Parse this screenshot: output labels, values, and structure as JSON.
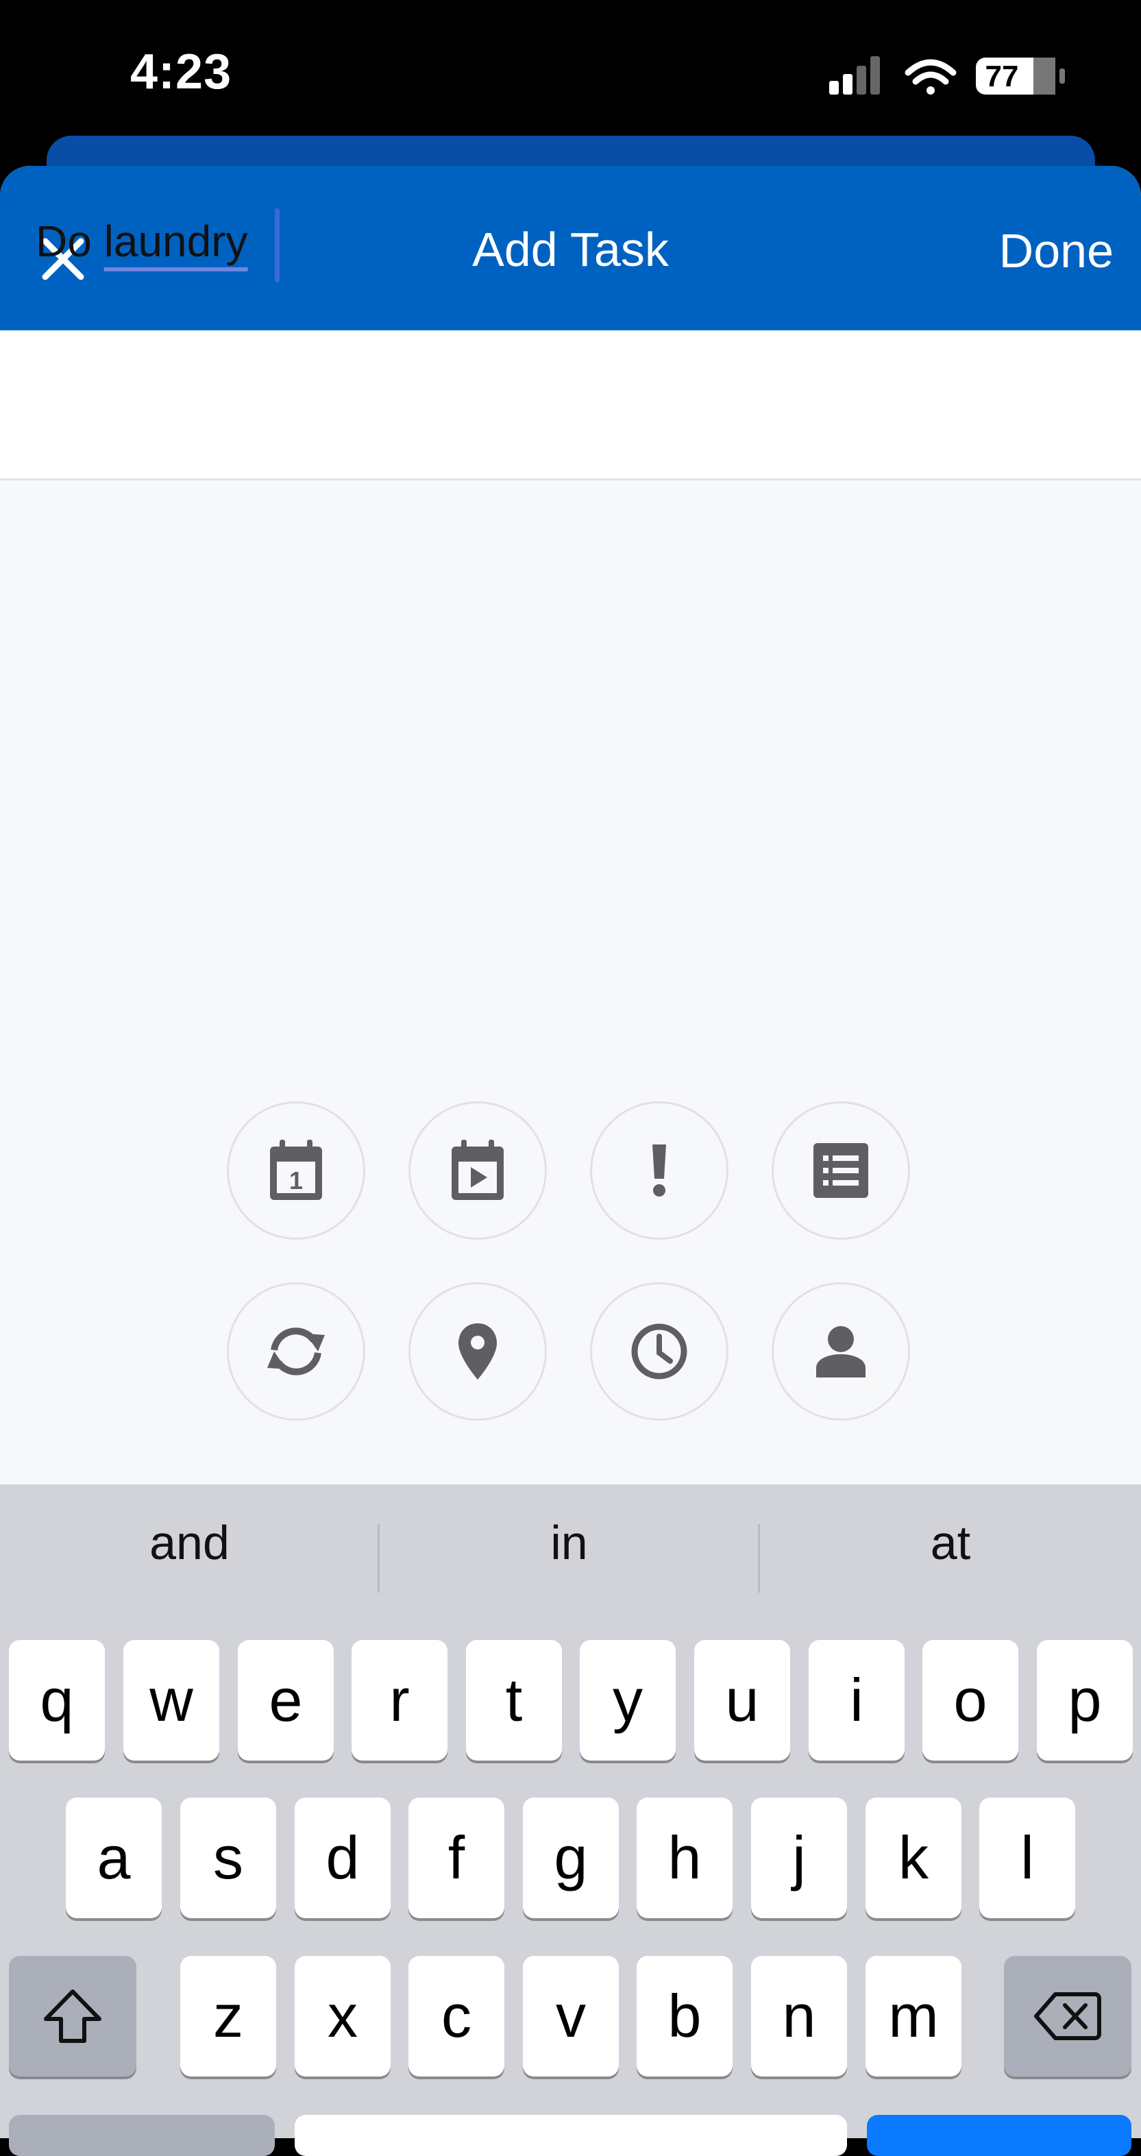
{
  "status_bar": {
    "time": "4:23",
    "battery": "77",
    "icons": [
      "cellular-signal-icon",
      "wifi-icon",
      "battery-icon"
    ]
  },
  "header": {
    "title": "Add Task",
    "done_label": "Done",
    "close_icon": "close-icon"
  },
  "task_input": {
    "value_part1": "Do ",
    "value_part2": "laundry"
  },
  "toolbar": {
    "row1": [
      "due-date-icon",
      "start-date-icon",
      "priority-icon",
      "list-icon"
    ],
    "row2": [
      "repeat-icon",
      "location-icon",
      "reminder-icon",
      "assignee-icon"
    ]
  },
  "keyboard": {
    "suggestions": [
      "and",
      "in",
      "at"
    ],
    "row1": [
      "q",
      "w",
      "e",
      "r",
      "t",
      "y",
      "u",
      "i",
      "o",
      "p"
    ],
    "row2": [
      "a",
      "s",
      "d",
      "f",
      "g",
      "h",
      "j",
      "k",
      "l"
    ],
    "row3": [
      "z",
      "x",
      "c",
      "v",
      "b",
      "n",
      "m"
    ],
    "special_keys": [
      "shift-icon",
      "backspace-icon"
    ]
  },
  "colors": {
    "accent": "#0062C0",
    "caret": "#3F66E0",
    "icon": "#5F5F63"
  }
}
